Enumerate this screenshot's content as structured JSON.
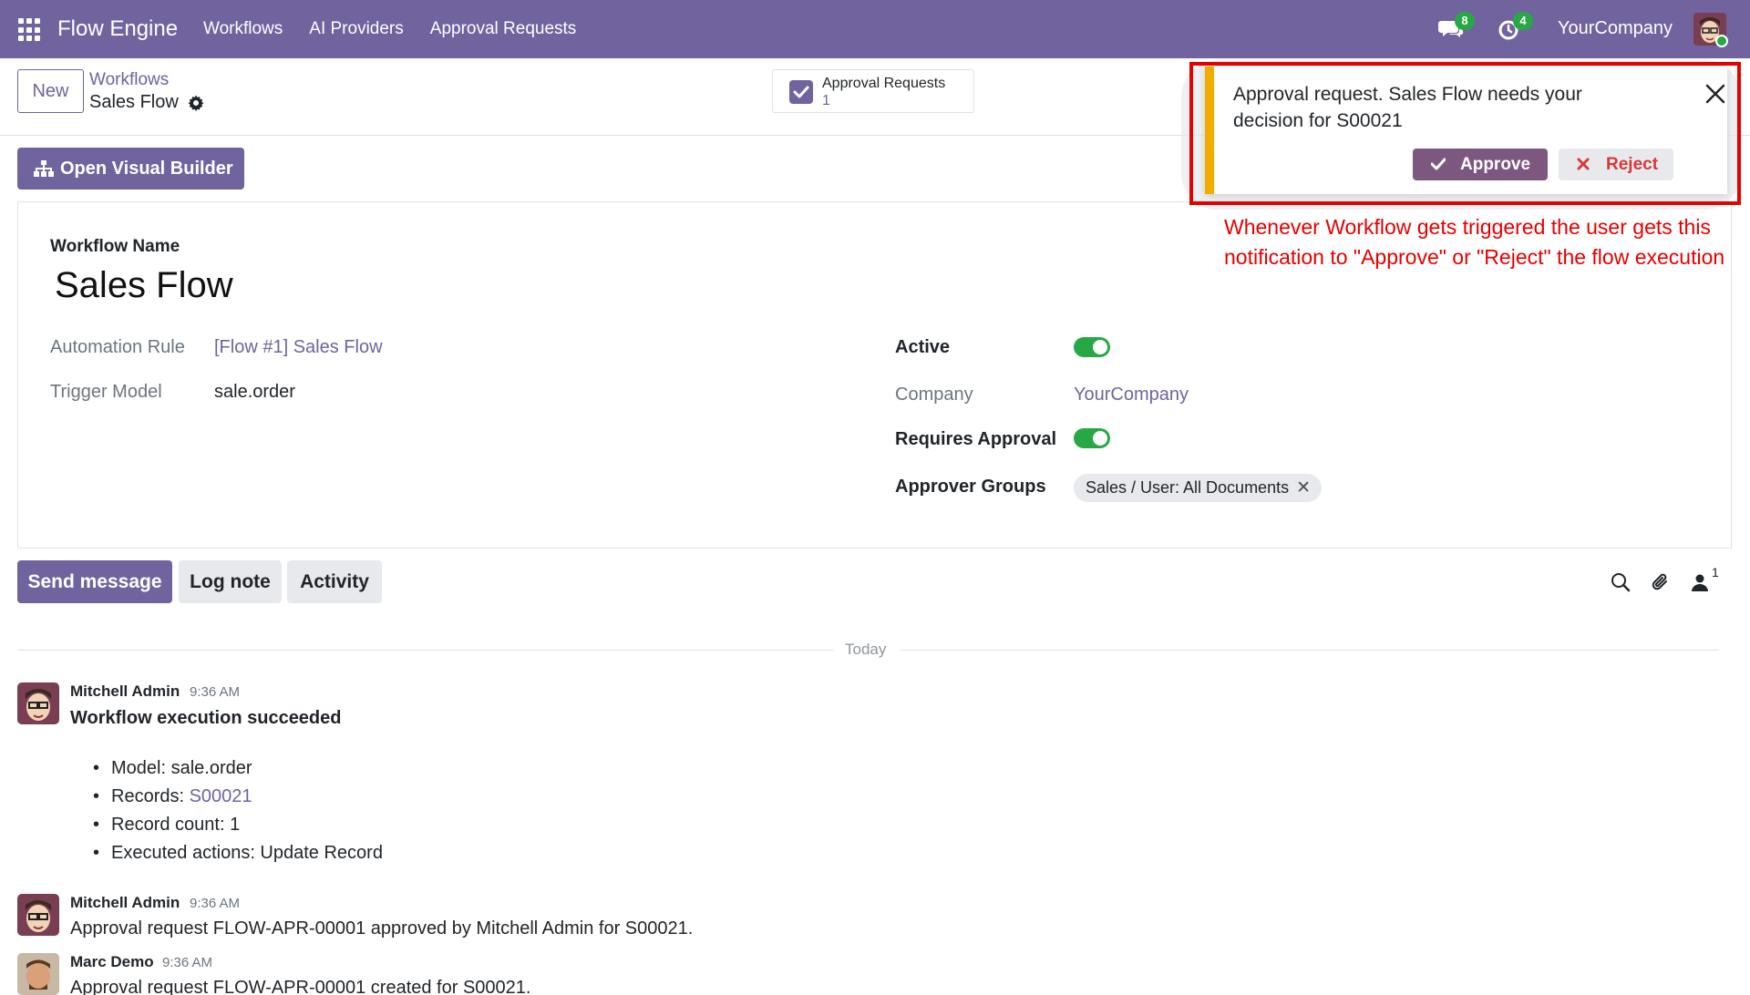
{
  "navbar": {
    "brand": "Flow Engine",
    "menu": [
      "Workflows",
      "AI Providers",
      "Approval Requests"
    ],
    "messages_badge": "8",
    "activities_badge": "4",
    "company": "YourCompany"
  },
  "control_panel": {
    "new_label": "New",
    "breadcrumb_parent": "Workflows",
    "breadcrumb_current": "Sales Flow",
    "smart_button": {
      "title": "Approval Requests",
      "count": "1"
    }
  },
  "form": {
    "builder_button": "Open Visual Builder",
    "name_label": "Workflow Name",
    "name_value": "Sales Flow",
    "automation_rule_label": "Automation Rule",
    "automation_rule_value": "[Flow #1] Sales Flow",
    "trigger_model_label": "Trigger Model",
    "trigger_model_value": "sale.order",
    "active_label": "Active",
    "active": true,
    "company_label": "Company",
    "company_value": "YourCompany",
    "requires_approval_label": "Requires Approval",
    "requires_approval": true,
    "approver_groups_label": "Approver Groups",
    "approver_groups": [
      "Sales / User: All Documents"
    ]
  },
  "chatter": {
    "send_message": "Send message",
    "log_note": "Log note",
    "activity": "Activity",
    "followers_count": "1",
    "divider": "Today",
    "messages": [
      {
        "author": "Mitchell Admin",
        "time": "9:36 AM",
        "title": "Workflow execution succeeded",
        "items": {
          "model": "Model: sale.order",
          "records_label": "Records: ",
          "records_link": "S00021",
          "count": "Record count: 1",
          "actions": "Executed actions: Update Record"
        }
      },
      {
        "author": "Mitchell Admin",
        "time": "9:36 AM",
        "body": "Approval request FLOW-APR-00001 approved by Mitchell Admin for S00021."
      },
      {
        "author": "Marc Demo",
        "time": "9:36 AM",
        "body": "Approval request FLOW-APR-00001 created for S00021."
      }
    ]
  },
  "notification": {
    "text": "Approval request. Sales Flow needs your decision for S00021",
    "approve": "Approve",
    "reject": "Reject"
  },
  "annotation": "Whenever Workflow gets triggered the user gets this notification to \"Approve\" or \"Reject\" the flow execution",
  "colors": {
    "brand": "#71639e",
    "toggle_on": "#28a745",
    "notification_accent": "#f0ad00",
    "annotation_red": "#e60000"
  }
}
